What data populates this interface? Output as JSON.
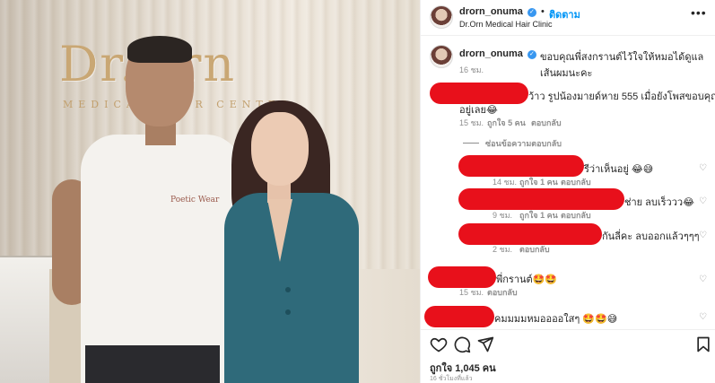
{
  "photo": {
    "sign_text": "Dr.Orn",
    "sign_subtext": "MEDICAL HAIR CENTER",
    "shirt_print": "Poetic Wear"
  },
  "header": {
    "username": "drorn_onuma",
    "verified_mark": "✓",
    "separator": "•",
    "follow_label": "ติดตาม",
    "subtitle": "Dr.Orn Medical Hair Clinic",
    "more_icon": "more-horizontal-icon",
    "more_glyph": "•••"
  },
  "caption": {
    "username": "drorn_onuma",
    "text": "ขอบคุณพี่สงกรานต์ไว้ใจให้หมอได้ดูแลเส้นผมนะคะ",
    "time": "16 ชม."
  },
  "comments": [
    {
      "text_line1": "ว้าว รูปน้องมายด์หาย 555 เมื่อยังโพสขอบคุณทั้งสอง",
      "text_line2": "อยู่เลย😂",
      "time": "15 ชม.",
      "likes": "ถูกใจ 5 คน",
      "reply": "ตอบกลับ"
    }
  ],
  "view_replies": "ซ่อนข้อความตอบกลับ",
  "replies": [
    {
      "text": "รีว่าเห็นอยู่ 😂😅",
      "time": "14 ชม.",
      "likes": "ถูกใจ 1 คน",
      "reply": "ตอบกลับ"
    },
    {
      "text": "ช่าย ลบเร็ววว😂",
      "time": "9 ชม.",
      "likes": "ถูกใจ 1 คน",
      "reply": "ตอบกลับ"
    },
    {
      "text": "กันลี่คะ ลบออกแล้วๆๆๆ",
      "time": "2 ชม.",
      "likes": "",
      "reply": "ตอบกลับ"
    }
  ],
  "comments_more": [
    {
      "text": "พี่กรานต์🤩🤩",
      "time": "15 ชม.",
      "reply": "ตอบกลับ"
    },
    {
      "text": "คมมมมหมออออใสๆ 🤩🤩😅",
      "time": "",
      "reply": ""
    }
  ],
  "actions": {
    "like_icon": "heart-icon",
    "comment_icon": "comment-icon",
    "share_icon": "send-icon",
    "save_icon": "bookmark-icon"
  },
  "likes": "ถูกใจ 1,045 คน",
  "posted": "16 ชั่วโมงที่แล้ว",
  "colors": {
    "accent": "#0095f6",
    "verified": "#3897f0",
    "redaction": "#e8101b",
    "muted": "#8e8e8e"
  }
}
